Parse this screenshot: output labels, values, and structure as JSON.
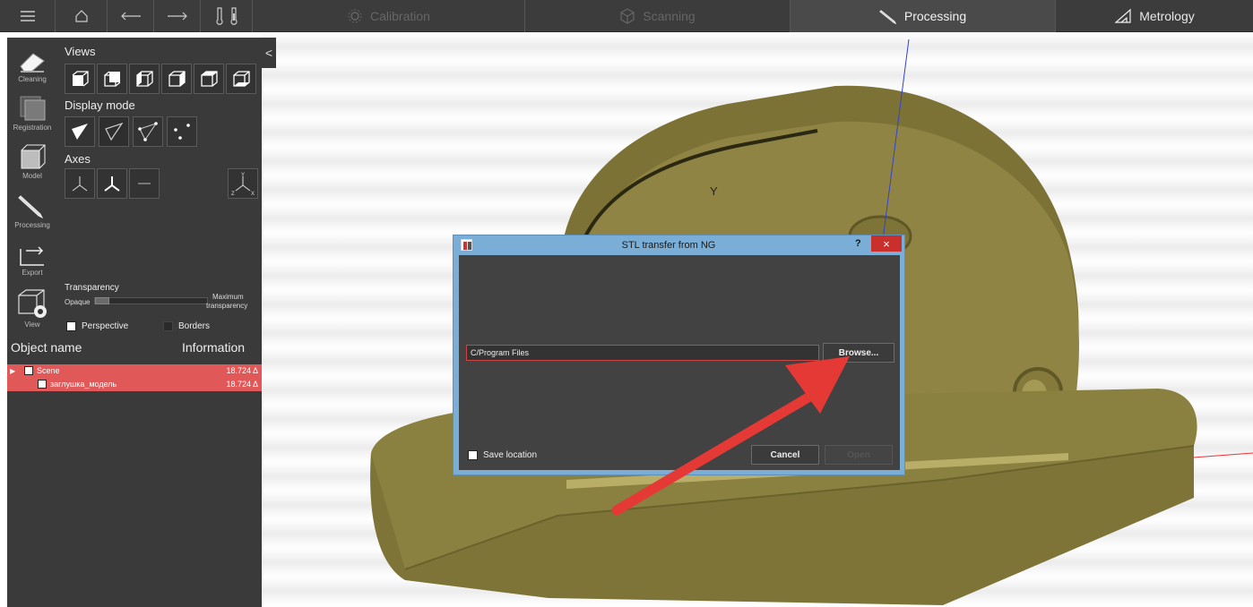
{
  "topbar": {
    "modes": [
      {
        "label": "Calibration",
        "icon": "gear-icon"
      },
      {
        "label": "Scanning",
        "icon": "cube-icon"
      },
      {
        "label": "Processing",
        "icon": "pen-icon"
      },
      {
        "label": "Metrology",
        "icon": "set-square-icon"
      }
    ],
    "active_mode": "Processing"
  },
  "toolbar": {
    "items": [
      {
        "label": "Cleaning",
        "icon": "eraser-icon"
      },
      {
        "label": "Registration",
        "icon": "registration-icon"
      },
      {
        "label": "Model",
        "icon": "model-icon"
      },
      {
        "label": "Processing",
        "icon": "pencil-icon"
      },
      {
        "label": "Export",
        "icon": "export-icon"
      },
      {
        "label": "View",
        "icon": "eye-cube-icon"
      }
    ]
  },
  "views_panel": {
    "views_title": "Views",
    "display_mode_title": "Display mode",
    "axes_title": "Axes",
    "transparency_title": "Transparency",
    "opaque_label": "Opaque",
    "maximum_label": "Maximum",
    "transparency_label": "transparency",
    "transparency_level": 0.0,
    "perspective_label": "Perspective",
    "borders_label": "Borders",
    "axis_x": "X",
    "axis_y": "Y",
    "axis_z": "Z"
  },
  "object_panel": {
    "col_name": "Object name",
    "col_info": "Information",
    "rows": [
      {
        "name": "Scene",
        "info": "18.724 Δ"
      },
      {
        "name": "заглушка_модель",
        "info": "18.724 Δ"
      }
    ]
  },
  "viewport": {
    "axis_label": "Y"
  },
  "dialog": {
    "title": "STL transfer from NG",
    "help_label": "?",
    "close_label": "×",
    "path_value": "C/Program Files",
    "browse_label": "Browse...",
    "save_location_label": "Save location",
    "cancel_label": "Cancel",
    "open_label": "Open"
  },
  "colors": {
    "panel": "#3a3a3a",
    "accent_row": "#e05858",
    "dialog_frame": "#7aaed6",
    "close_red": "#c9302c",
    "model_olive": "#8a7f3f",
    "annotation_arrow": "#e53935"
  }
}
